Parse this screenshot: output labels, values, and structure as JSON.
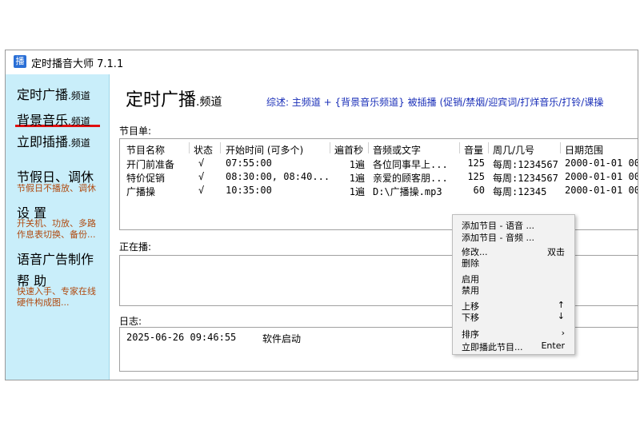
{
  "window": {
    "title": "定时播音大师 7.1.1",
    "icon_char": "播"
  },
  "sidebar": {
    "items": [
      {
        "label": "定时广播",
        "suffix": ".频道"
      },
      {
        "label": "背景音乐",
        "suffix": ".频道"
      },
      {
        "label": "立即插播",
        "suffix": ".频道"
      },
      {
        "label": "节假日、调休",
        "sub": [
          "节假日不播放、调休"
        ]
      },
      {
        "label": "设 置",
        "sub": [
          "开关机、功放、多路",
          "作息表切换、备份..."
        ]
      },
      {
        "label": "语音广告制作"
      },
      {
        "label": "帮 助",
        "sub": [
          "快速入手、专家在线",
          "硬件构成图..."
        ]
      }
    ],
    "accent_color": "#e01010",
    "background_color": "#c9eefa"
  },
  "main": {
    "title": "定时广播",
    "title_suffix": ".频道",
    "summary": "综述:  主频道 + {背景音乐频道} 被插播    (促销/禁烟/迎宾词/打烊音乐/打铃/课操",
    "program_list_label": "节目单:",
    "columns": [
      "节目名称",
      "状态",
      "开始时间 (可多个)",
      "遍首秒",
      "音频或文字",
      "音量",
      "周几/几号",
      "日期范围"
    ],
    "rows": [
      {
        "name": "开门前准备",
        "status": "√",
        "time": "07:55:00",
        "repeat": "1遍",
        "audio": "各位同事早上...",
        "volume": "125",
        "days": "每周:1234567",
        "range": "2000-01-01 00"
      },
      {
        "name": "特价促销",
        "status": "√",
        "time": "08:30:00, 08:40...",
        "repeat": "1遍",
        "audio": "亲爱的顾客朋...",
        "volume": "125",
        "days": "每周:1234567",
        "range": "2000-01-01 00"
      },
      {
        "name": "广播操",
        "status": "√",
        "time": "10:35:00",
        "repeat": "1遍",
        "audio": "D:\\广播操.mp3",
        "volume": "60",
        "days": "每周:12345",
        "range": "2000-01-01 00"
      }
    ],
    "now_playing_label": "正在播:",
    "log_label": "日志:",
    "log_entries": [
      {
        "timestamp": "2025-06-26 09:46:55",
        "message": "软件启动"
      }
    ]
  },
  "context_menu": {
    "items": [
      {
        "label": "添加节目 - 语音 ...",
        "key": ""
      },
      {
        "label": "添加节目 - 音频 ...",
        "key": ""
      },
      {
        "label": "修改...",
        "key": "双击"
      },
      {
        "label": "删除",
        "key": ""
      },
      {
        "label": "启用",
        "key": ""
      },
      {
        "label": "禁用",
        "key": ""
      },
      {
        "label": "上移",
        "key": "↑"
      },
      {
        "label": "下移",
        "key": "↓"
      },
      {
        "label": "排序",
        "key": "›"
      },
      {
        "label": "立即播此节目...",
        "key": "Enter"
      }
    ]
  },
  "colors": {
    "summary_text": "#1a2fb8",
    "sidebar_sub_text": "#b04a10"
  }
}
